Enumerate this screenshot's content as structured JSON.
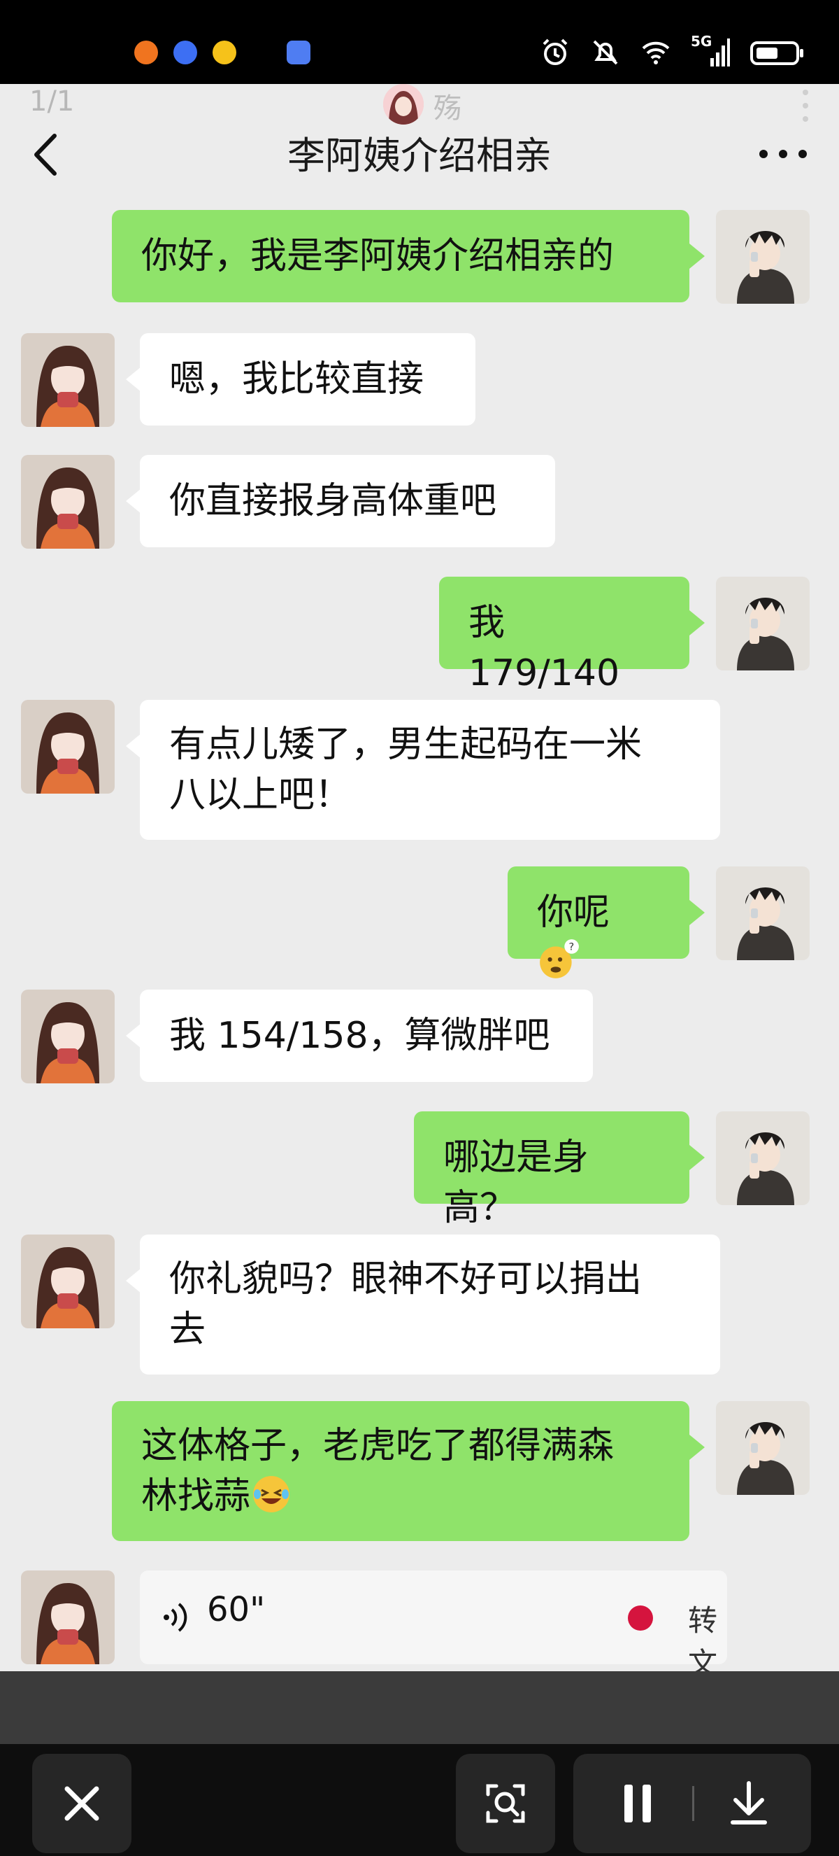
{
  "status_bar": {
    "signal_label": "5G"
  },
  "viewer": {
    "pager": "1/1",
    "username": "殇"
  },
  "header": {
    "title": "李阿姨介绍相亲"
  },
  "messages": [
    {
      "side": "right",
      "text": "你好，我是李阿姨介绍相亲的"
    },
    {
      "side": "left",
      "text": "嗯，我比较直接"
    },
    {
      "side": "left",
      "text": "你直接报身高体重吧"
    },
    {
      "side": "right",
      "text": "我 179/140"
    },
    {
      "side": "left",
      "line1": "有点儿矮了，男生起码在一米",
      "line2": "八以上吧！"
    },
    {
      "side": "right",
      "text": "你呢"
    },
    {
      "side": "left",
      "text": "我 154/158，算微胖吧"
    },
    {
      "side": "right",
      "text": "哪边是身高？"
    },
    {
      "side": "left",
      "line1": "你礼貌吗？眼神不好可以捐出",
      "line2": "去"
    },
    {
      "side": "right",
      "line1": "这体格子，老虎吃了都得满森",
      "line2": "林找蒜"
    }
  ],
  "voice": {
    "duration": "60\"",
    "convert_label": "转文字"
  },
  "colors": {
    "green_bubble": "#8fe36a",
    "white_bubble": "#ffffff",
    "chat_bg": "#ececec",
    "record_dot": "#d5143e"
  },
  "icons": [
    "back-icon",
    "more-icon",
    "close-icon",
    "scan-icon",
    "pause-icon",
    "download-icon",
    "voice-wave-icon",
    "alarm-icon",
    "mute-icon",
    "wifi-icon",
    "battery-icon"
  ]
}
